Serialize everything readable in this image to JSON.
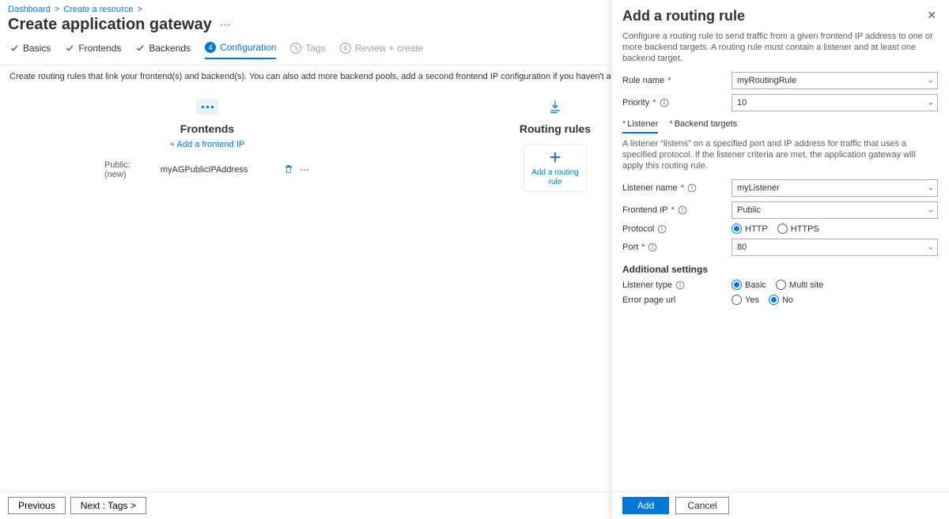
{
  "breadcrumb": {
    "items": [
      "Dashboard",
      "Create a resource"
    ]
  },
  "page": {
    "title": "Create application gateway"
  },
  "steps": {
    "basics": "Basics",
    "frontends": "Frontends",
    "backends": "Backends",
    "configuration_num": "4",
    "configuration": "Configuration",
    "tags_num": "5",
    "tags": "Tags",
    "review_num": "6",
    "review": "Review + create"
  },
  "main": {
    "description": "Create routing rules that link your frontend(s) and backend(s). You can also add more backend pools, add a second frontend IP configuration if you haven't already, or edit previous configurations.",
    "frontends_title": "Frontends",
    "add_frontend_link": "+ Add a frontend IP",
    "frontend_row_label": "Public: (new)",
    "frontend_row_name": "myAGPublicIPAddress",
    "routing_rules_title": "Routing rules",
    "add_rule_card": "Add a routing rule"
  },
  "footer": {
    "previous": "Previous",
    "next": "Next : Tags >"
  },
  "panel": {
    "title": "Add a routing rule",
    "description": "Configure a routing rule to send traffic from a given frontend IP address to one or more backend targets. A routing rule must contain a listener and at least one backend target.",
    "rule_name_label": "Rule name",
    "rule_name_value": "myRoutingRule",
    "priority_label": "Priority",
    "priority_value": "10",
    "tab_listener": "Listener",
    "tab_backend": "Backend targets",
    "listener_desc": "A listener “listens” on a specified port and IP address for traffic that uses a specified protocol. If the listener criteria are met, the application gateway will apply this routing rule.",
    "listener_name_label": "Listener name",
    "listener_name_value": "myListener",
    "frontend_ip_label": "Frontend IP",
    "frontend_ip_value": "Public",
    "protocol_label": "Protocol",
    "protocol_http": "HTTP",
    "protocol_https": "HTTPS",
    "port_label": "Port",
    "port_value": "80",
    "additional_settings": "Additional settings",
    "listener_type_label": "Listener type",
    "listener_type_basic": "Basic",
    "listener_type_multi": "Multi site",
    "error_page_label": "Error page url",
    "error_page_yes": "Yes",
    "error_page_no": "No",
    "add_btn": "Add",
    "cancel_btn": "Cancel"
  }
}
